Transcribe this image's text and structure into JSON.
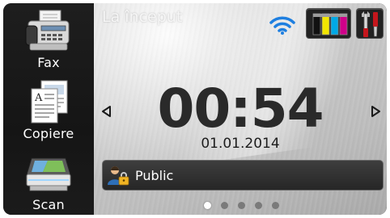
{
  "sidebar": {
    "items": [
      {
        "label": "Fax",
        "icon": "fax-machine-icon"
      },
      {
        "label": "Copiere",
        "icon": "copy-documents-icon"
      },
      {
        "label": "Scan",
        "icon": "scanner-icon"
      }
    ]
  },
  "header": {
    "title": "La început",
    "wifi_icon": "wifi-icon",
    "ink_icon": "ink-level-icon",
    "tools_icon": "tools-icon"
  },
  "clock": {
    "time": "00:54",
    "date": "01.01.2014"
  },
  "profile": {
    "label": "Public",
    "icon": "user-lock-icon"
  },
  "pager": {
    "pages": 5,
    "current": 1
  },
  "colors": {
    "wifi": "#1e7fe0",
    "ink_black": "#111111",
    "ink_yellow": "#f2e600",
    "ink_cyan": "#00a9e6",
    "ink_magenta": "#d0008a",
    "sidebar_bg": "#1a1a1a",
    "bar_bg": "#2e2e2e"
  }
}
